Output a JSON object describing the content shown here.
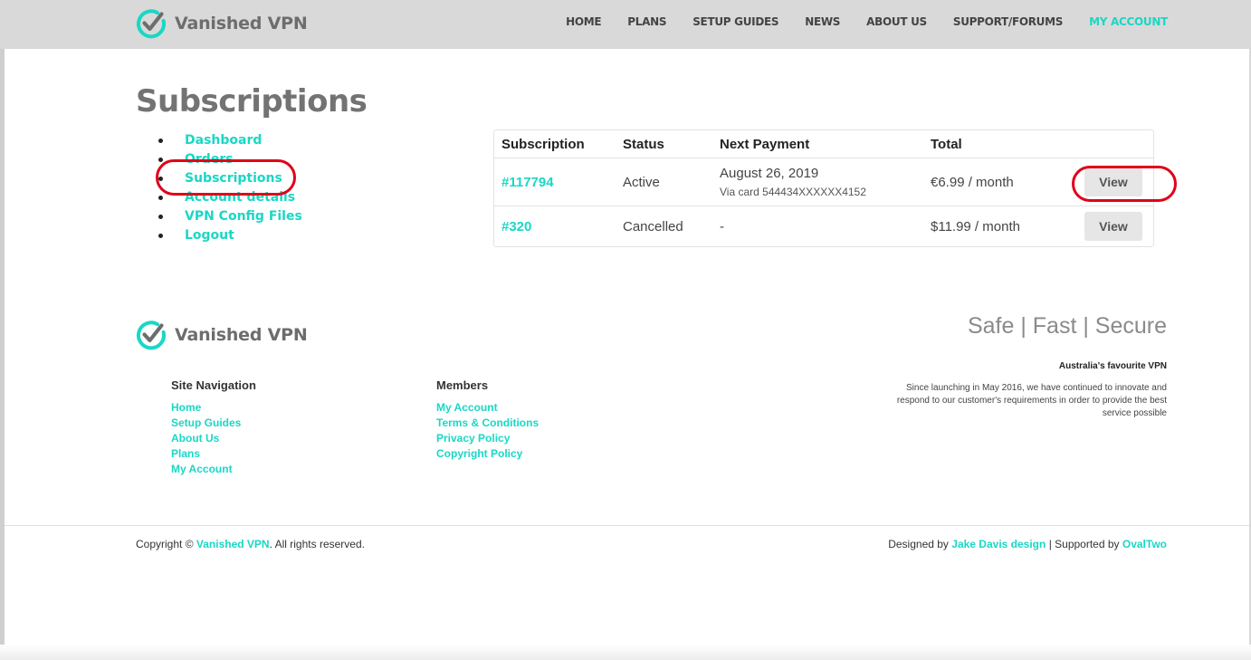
{
  "brand": {
    "name": "Vanished VPN",
    "accent_color": "#1ad7c5",
    "logo_icon": "check-circle-icon"
  },
  "nav": {
    "items": [
      {
        "label": "HOME",
        "active": false
      },
      {
        "label": "PLANS",
        "active": false
      },
      {
        "label": "SETUP GUIDES",
        "active": false
      },
      {
        "label": "NEWS",
        "active": false
      },
      {
        "label": "ABOUT US",
        "active": false
      },
      {
        "label": "SUPPORT/FORUMS",
        "active": false
      },
      {
        "label": "MY ACCOUNT",
        "active": true
      }
    ]
  },
  "page": {
    "title": "Subscriptions"
  },
  "account_menu": {
    "items": [
      {
        "label": "Dashboard"
      },
      {
        "label": "Orders"
      },
      {
        "label": "Subscriptions"
      },
      {
        "label": "Account details"
      },
      {
        "label": "VPN Config Files"
      },
      {
        "label": "Logout"
      }
    ]
  },
  "subscriptions": {
    "columns": [
      "Subscription",
      "Status",
      "Next Payment",
      "Total"
    ],
    "rows": [
      {
        "id": "#117794",
        "status": "Active",
        "next_payment": "August 26, 2019",
        "payment_note": "Via card 544434XXXXXX4152",
        "total": "€6.99 / month",
        "action": "View"
      },
      {
        "id": "#320",
        "status": "Cancelled",
        "next_payment": "-",
        "payment_note": "",
        "total": "$11.99 / month",
        "action": "View"
      }
    ]
  },
  "annotations": {
    "highlight_color": "#e0001a"
  },
  "footer": {
    "tagline": "Safe | Fast | Secure",
    "site_nav": {
      "title": "Site Navigation",
      "links": [
        "Home",
        "Setup Guides",
        "About Us",
        "Plans",
        "My Account"
      ]
    },
    "members": {
      "title": "Members",
      "links": [
        "My Account",
        "Terms & Conditions",
        "Privacy Policy",
        "Copyright Policy"
      ]
    },
    "favourite": "Australia's favourite VPN",
    "about": "Since launching in May 2016, we have continued to innovate and respond to our customer's requirements in order to provide the best service possible",
    "copyright_prefix": "Copyright ©",
    "copyright_brand": "Vanished VPN",
    "copyright_suffix": ". All rights reserved.",
    "designed_prefix": "Designed by",
    "designer": "Jake Davis design",
    "supported_prefix": "| Supported by",
    "supporter": "OvalTwo"
  }
}
